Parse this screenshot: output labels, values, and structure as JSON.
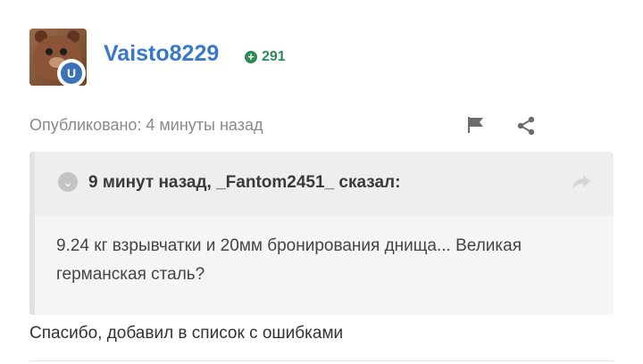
{
  "author": {
    "username": "Vaisto8229",
    "reputation": "291",
    "avatar_icon": "bear-avatar",
    "badge_letter": "U",
    "rep_icon": "plus-circle-icon"
  },
  "post": {
    "posted_label": "Опубликовано: 4 минуты назад",
    "reply_text": "Спасибо, добавил в список с ошибками"
  },
  "quote": {
    "header": "9 минут назад, _Fantom2451_ сказал:",
    "body": "9.24 кг взрывчатки и 20мм бронирования днища... Великая германская сталь?"
  },
  "colors": {
    "username": "#3a78c9",
    "reputation": "#2e8b57",
    "badge": "#3b73b9"
  }
}
